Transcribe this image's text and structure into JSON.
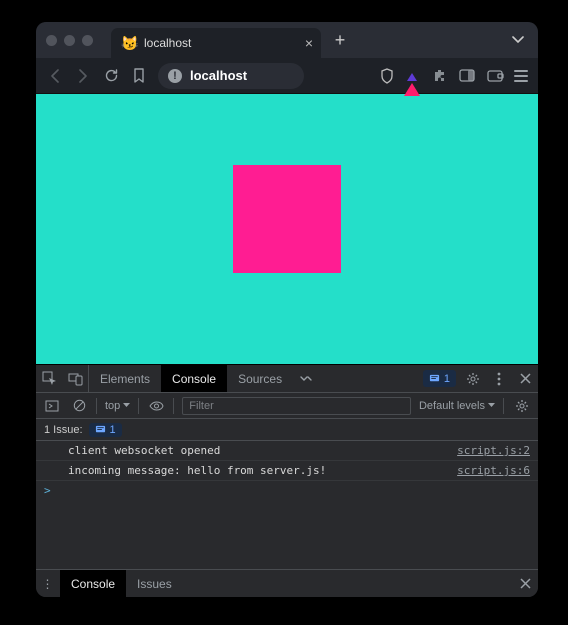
{
  "window": {
    "tab": {
      "title": "localhost",
      "favicon": "😼"
    }
  },
  "toolbar": {
    "url_display": "localhost"
  },
  "devtools": {
    "tabs": {
      "elements": "Elements",
      "console": "Console",
      "sources": "Sources"
    },
    "issue_count": "1",
    "filter": {
      "context": "top",
      "placeholder": "Filter",
      "levels": "Default levels"
    },
    "issues_bar": {
      "label": "1 Issue:",
      "count": "1"
    },
    "logs": [
      {
        "msg": "client websocket opened",
        "src": "script.js:2"
      },
      {
        "msg": "incoming message: hello from server.js!",
        "src": "script.js:6"
      }
    ],
    "prompt": ">",
    "drawer": {
      "console": "Console",
      "issues": "Issues"
    }
  }
}
